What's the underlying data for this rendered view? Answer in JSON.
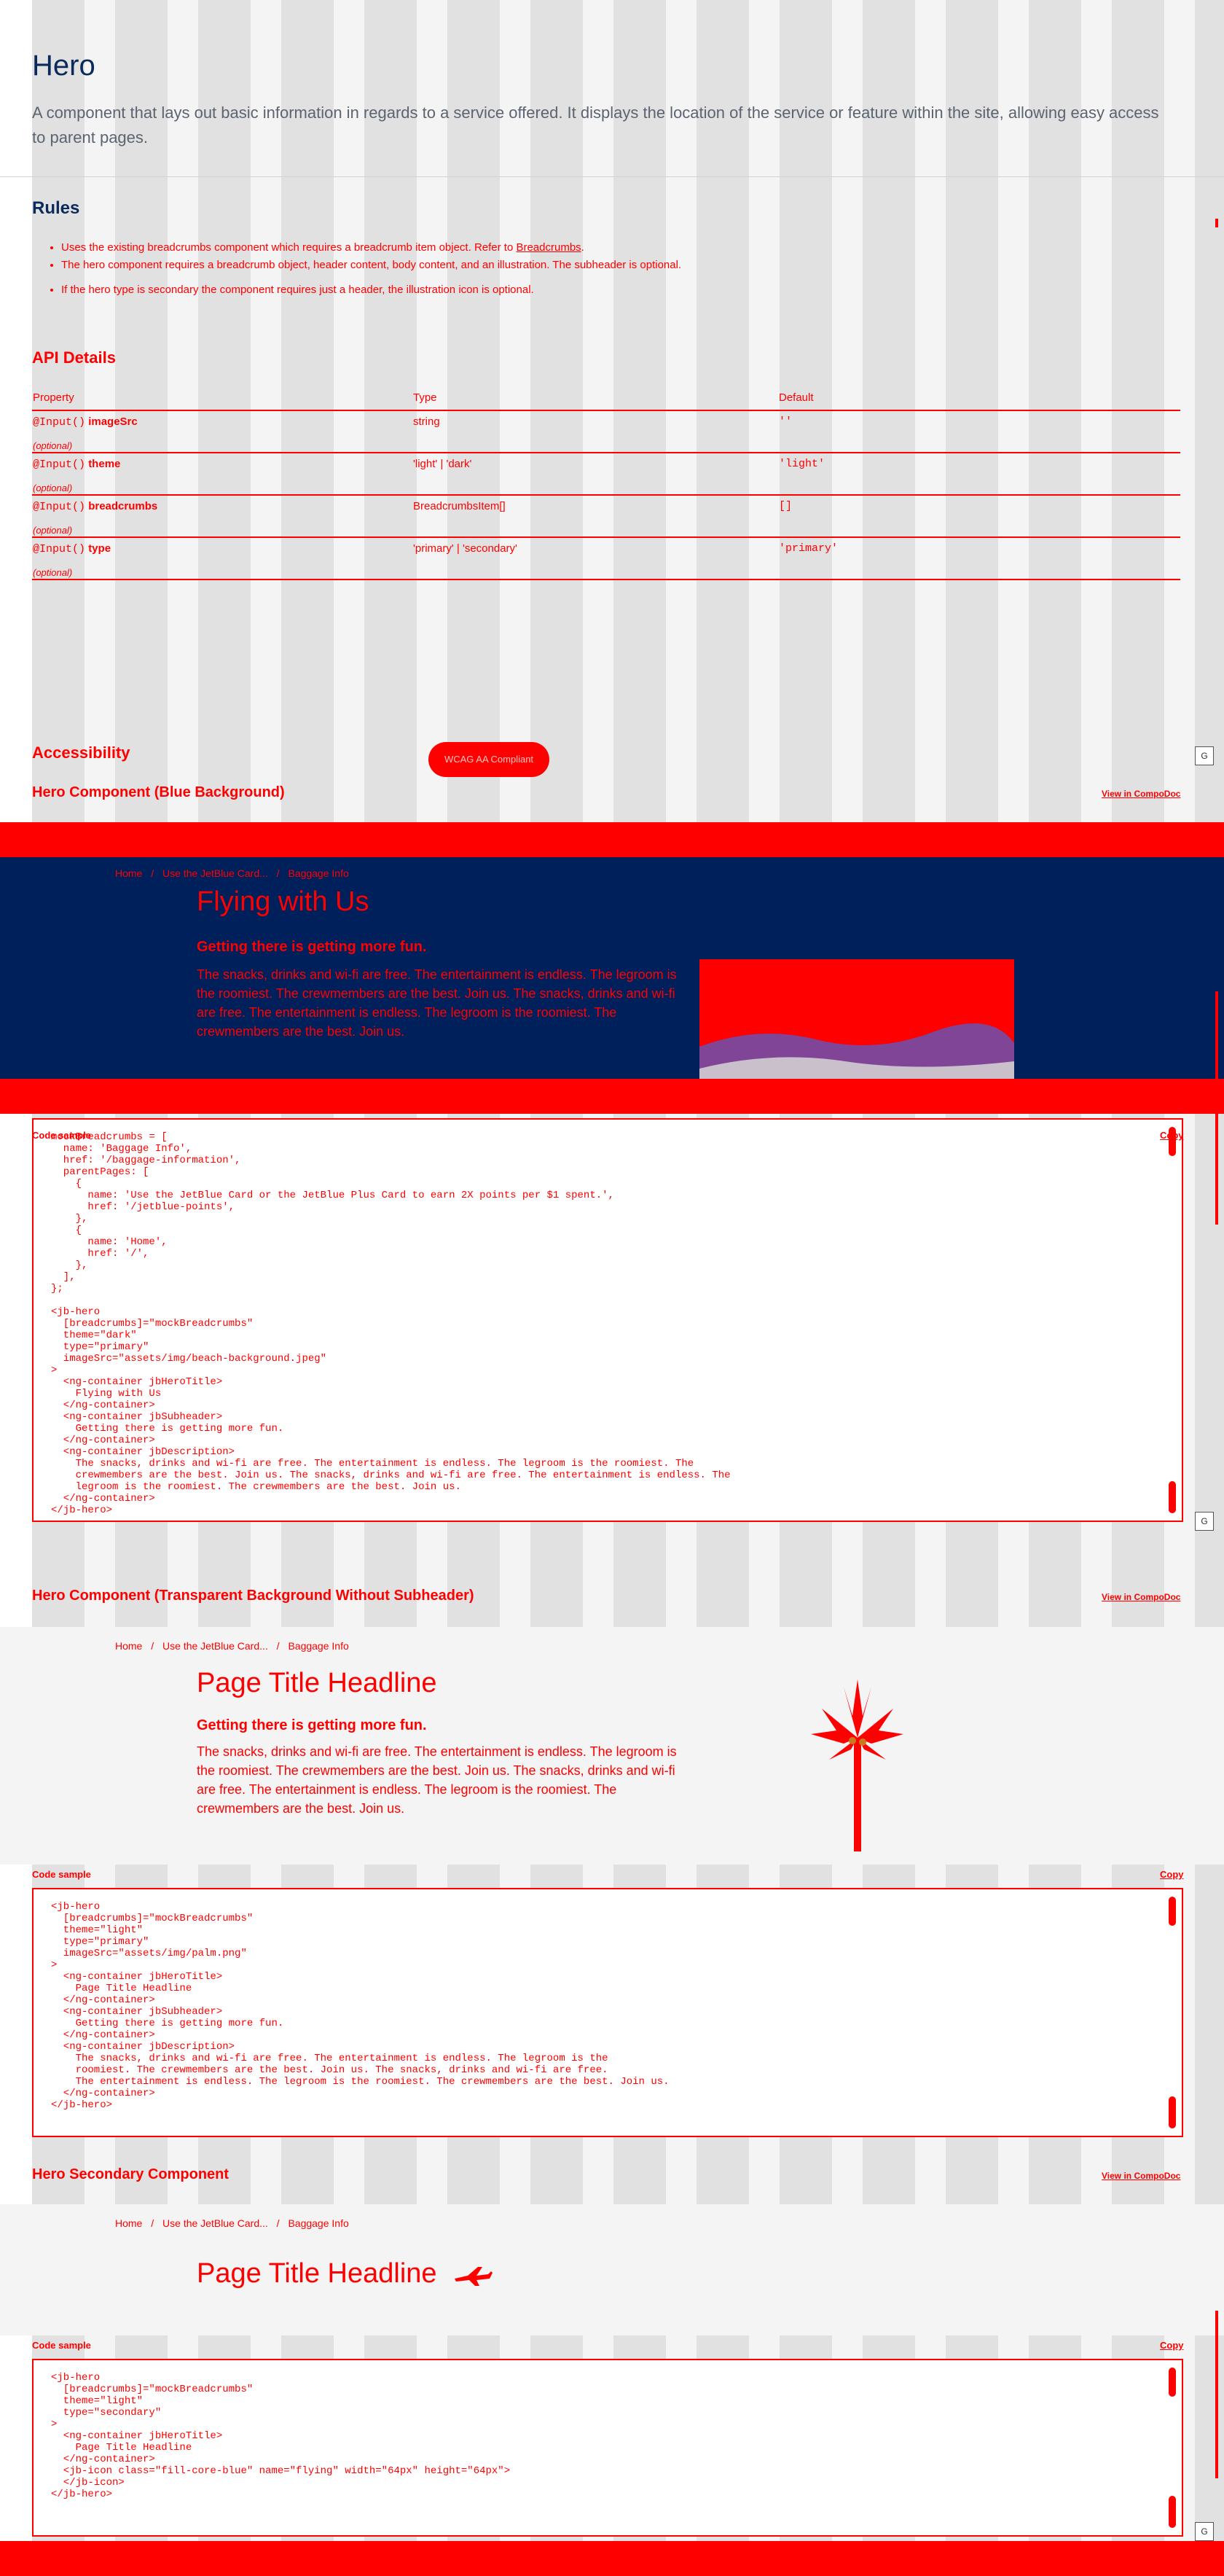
{
  "header": {
    "title": "Hero",
    "intro": "A component that lays out basic information in regards to a service offered. It displays the location of the service or feature within the site, allowing easy access to parent pages."
  },
  "rules": {
    "heading": "Rules",
    "item1_prefix": "Uses the existing breadcrumbs component which requires a breadcrumb item object. Refer to",
    "item1_link": "Breadcrumbs",
    "item2": "The hero component requires a breadcrumb object, header content, body content, and an illustration. The subheader is optional.",
    "item3": "If the hero type is secondary the component requires just a header, the illustration icon is optional."
  },
  "api": {
    "heading": "API Details",
    "columns": [
      "Property",
      "Type",
      "Default"
    ],
    "rows": [
      {
        "prefix": "@Input()",
        "name": "imageSrc",
        "type": "string",
        "default": "''",
        "optional": "(optional)"
      },
      {
        "prefix": "@Input()",
        "name": "theme",
        "type": "'light' | 'dark'",
        "default": "'light'",
        "optional": "(optional)"
      },
      {
        "prefix": "@Input()",
        "name": "breadcrumbs",
        "type": "BreadcrumbsItem[]",
        "default": "[]",
        "optional": "(optional)"
      },
      {
        "prefix": "@Input()",
        "name": "type",
        "type": "'primary' | 'secondary'",
        "default": "'primary'",
        "optional": "(optional)"
      }
    ]
  },
  "accessibility": {
    "heading": "Accessibility",
    "badge": "WCAG AA Compliant"
  },
  "sections": {
    "blue": {
      "title": "Hero Component (Blue Background)",
      "view_link": "View in CompoDoc"
    },
    "transparent": {
      "title": "Hero Component (Transparent Background Without Subheader)",
      "view_link": "View in CompoDoc"
    },
    "secondary": {
      "title": "Hero Secondary Component",
      "view_link": "View in CompoDoc"
    }
  },
  "breadcrumbs": {
    "home": "Home",
    "separator": "/",
    "parent": "Use the JetBlue Card...",
    "current": "Baggage Info"
  },
  "hero_blue": {
    "title": "Flying with Us",
    "subheader": "Getting there is getting more fun.",
    "body": "The snacks, drinks and wi-fi are free. The entertainment is endless. The legroom is the roomiest. The crewmembers are the best. Join us. The snacks, drinks and wi-fi are free. The entertainment is endless. The legroom is the roomiest. The crewmembers are the best. Join us."
  },
  "hero_transparent": {
    "title": "Page Title Headline",
    "subheader": "Getting there is getting more fun.",
    "body": "The snacks, drinks and wi-fi are free. The entertainment is endless. The legroom is the roomiest. The crewmembers are the best. Join us. The snacks, drinks and wi-fi are free. The entertainment is endless. The legroom is the roomiest. The crewmembers are the best. Join us."
  },
  "hero_secondary": {
    "title": "Page Title Headline"
  },
  "code": {
    "label": "Code sample",
    "copy": "Copy",
    "blue": "mockBreadcrumbs = [\n  name: 'Baggage Info',\n  href: '/baggage-information',\n  parentPages: [\n    {\n      name: 'Use the JetBlue Card or the JetBlue Plus Card to earn 2X points per $1 spent.',\n      href: '/jetblue-points',\n    },\n    {\n      name: 'Home',\n      href: '/',\n    },\n  ],\n};\n\n<jb-hero\n  [breadcrumbs]=\"mockBreadcrumbs\"\n  theme=\"dark\"\n  type=\"primary\"\n  imageSrc=\"assets/img/beach-background.jpeg\"\n>\n  <ng-container jbHeroTitle>\n    Flying with Us\n  </ng-container>\n  <ng-container jbSubheader>\n    Getting there is getting more fun.\n  </ng-container>\n  <ng-container jbDescription>\n    The snacks, drinks and wi-fi are free. The entertainment is endless. The legroom is the roomiest. The\n    crewmembers are the best. Join us. The snacks, drinks and wi-fi are free. The entertainment is endless. The\n    legroom is the roomiest. The crewmembers are the best. Join us.\n  </ng-container>\n</jb-hero>",
    "transparent": "<jb-hero\n  [breadcrumbs]=\"mockBreadcrumbs\"\n  theme=\"light\"\n  type=\"primary\"\n  imageSrc=\"assets/img/palm.png\"\n>\n  <ng-container jbHeroTitle>\n    Page Title Headline\n  </ng-container>\n  <ng-container jbSubheader>\n    Getting there is getting more fun.\n  </ng-container>\n  <ng-container jbDescription>\n    The snacks, drinks and wi-fi are free. The entertainment is endless. The legroom is the\n    roomiest. The crewmembers are the best. Join us. The snacks, drinks and wi-fi are free.\n    The entertainment is endless. The legroom is the roomiest. The crewmembers are the best. Join us.\n  </ng-container>\n</jb-hero>",
    "secondary": "<jb-hero\n  [breadcrumbs]=\"mockBreadcrumbs\"\n  theme=\"light\"\n  type=\"secondary\"\n>\n  <ng-container jbHeroTitle>\n    Page Title Headline\n  </ng-container>\n  <jb-icon class=\"fill-core-blue\" name=\"flying\" width=\"64px\" height=\"64px\">\n  </jb-icon>\n</jb-hero>"
  },
  "misc": {
    "g_button": "G"
  },
  "colors": {
    "navy": "#00205b",
    "accent": "#ff0000",
    "page_bg": "#ffffff",
    "hero_gray": "#f4f4f4"
  }
}
